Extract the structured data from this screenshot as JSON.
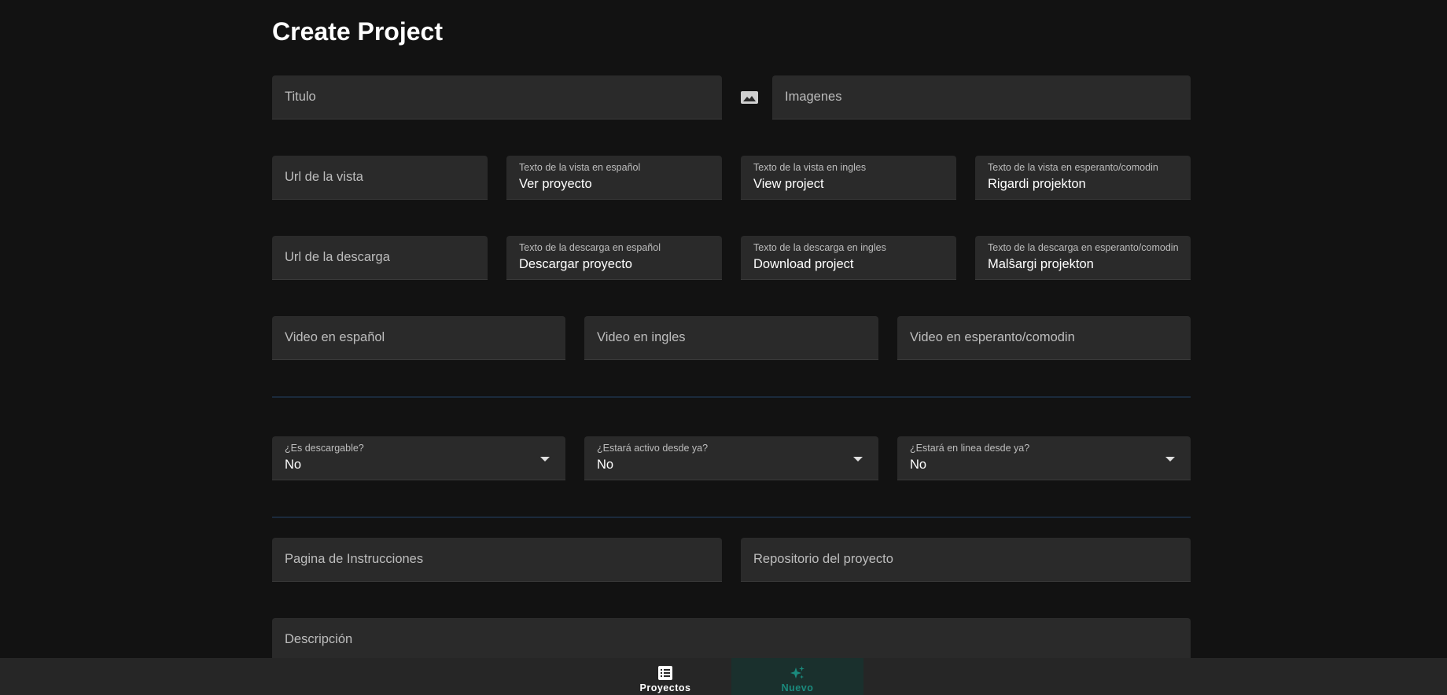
{
  "page_title": "Create Project",
  "row1": {
    "titulo": {
      "placeholder": "Titulo"
    },
    "imagenes": {
      "placeholder": "Imagenes",
      "icon": "image-icon"
    }
  },
  "row2": {
    "url_vista": {
      "placeholder": "Url de la vista"
    },
    "vista_es": {
      "label": "Texto de la vista en español",
      "value": "Ver proyecto"
    },
    "vista_en": {
      "label": "Texto de la vista en ingles",
      "value": "View project"
    },
    "vista_eo": {
      "label": "Texto de la vista en esperanto/comodin",
      "value": "Rigardi projekton"
    }
  },
  "row3": {
    "url_descarga": {
      "placeholder": "Url de la descarga"
    },
    "descarga_es": {
      "label": "Texto de la descarga en español",
      "value": "Descargar proyecto"
    },
    "descarga_en": {
      "label": "Texto de la descarga en ingles",
      "value": "Download project"
    },
    "descarga_eo": {
      "label": "Texto de la descarga en esperanto/comodin",
      "value": "Malŝargi projekton"
    }
  },
  "row4": {
    "video_es": {
      "placeholder": "Video en español"
    },
    "video_en": {
      "placeholder": "Video en ingles"
    },
    "video_eo": {
      "placeholder": "Video en esperanto/comodin"
    }
  },
  "selects": {
    "descargable": {
      "label": "¿Es descargable?",
      "value": "No"
    },
    "activo": {
      "label": "¿Estará activo desde ya?",
      "value": "No"
    },
    "en_linea": {
      "label": "¿Estará en linea desde ya?",
      "value": "No"
    }
  },
  "row6": {
    "instrucciones": {
      "placeholder": "Pagina de Instrucciones"
    },
    "repositorio": {
      "placeholder": "Repositorio del proyecto"
    }
  },
  "descripcion": {
    "placeholder": "Descripción"
  },
  "bottom_nav": {
    "projects": {
      "label": "Proyectos",
      "icon": "list-icon"
    },
    "new": {
      "label": "Nuevo",
      "icon": "sparkle-icon"
    }
  },
  "colors": {
    "background": "#121212",
    "field": "#2a2a2a",
    "accent": "#1a8a7d",
    "divider": "#1b2a3c"
  }
}
